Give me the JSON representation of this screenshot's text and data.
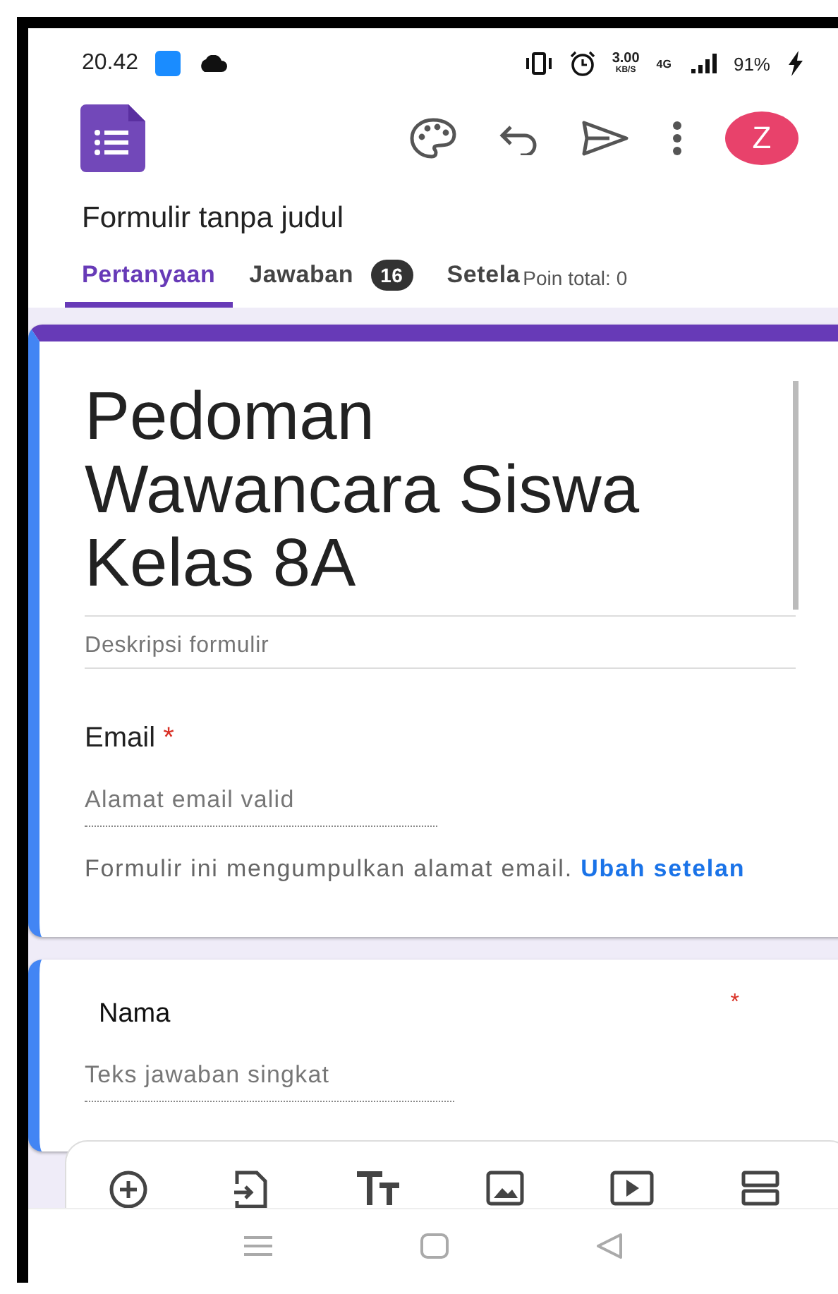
{
  "status_bar": {
    "time": "20.42",
    "speed": "3.00",
    "speed_unit": "KB/S",
    "network": "4G",
    "battery": "91%"
  },
  "app_bar": {
    "avatar": "Z"
  },
  "form_name": "Formulir tanpa judul",
  "tabs": [
    {
      "label": "Pertanyaan",
      "selected": true
    },
    {
      "label": "Jawaban",
      "selected": false,
      "badge": "16"
    },
    {
      "label": "Setela",
      "selected": false
    }
  ],
  "points": "Poin total: 0",
  "header": {
    "title": "Pedoman Wawancara Siswa Kelas 8A",
    "description_placeholder": "Deskripsi formulir"
  },
  "email": {
    "label": "Email",
    "required": true,
    "required_mark": "*",
    "placeholder": "Alamat email valid",
    "notice": "Formulir ini mengumpulkan alamat email.",
    "link": "Ubah setelan"
  },
  "question": {
    "title": "Nama",
    "required": true,
    "required_mark": "*",
    "placeholder": "Teks jawaban singkat"
  }
}
